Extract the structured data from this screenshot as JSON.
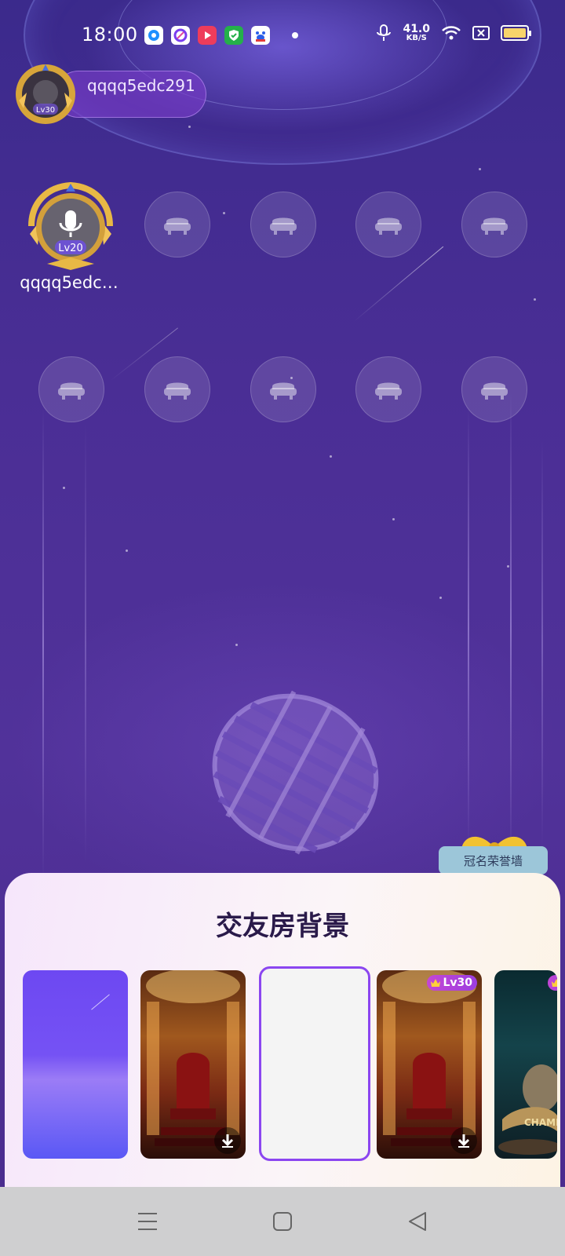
{
  "status_bar": {
    "time": "18:00",
    "apps": [
      "circle-app-icon",
      "ring-app-icon",
      "video-app-icon",
      "shield-app-icon",
      "baidu-app-icon"
    ],
    "net_speed": "41.0",
    "net_unit": "KB/S",
    "battery_color": "#f7d46b"
  },
  "owner": {
    "name": "qqqq5edc291",
    "level": "Lv30"
  },
  "host_seat": {
    "name": "qqqq5edc…",
    "level": "Lv20",
    "icon": "microphone-icon"
  },
  "empty_seat_icon": "sofa-icon",
  "honor_wall": {
    "label": "冠名荣誉墙"
  },
  "background_sheet": {
    "title": "交友房背景",
    "cards": [
      {
        "theme": "purple-galaxy"
      },
      {
        "theme": "golden-throne",
        "downloadable": true
      },
      {
        "theme": "blank",
        "selected": true
      },
      {
        "theme": "golden-throne",
        "level": "Lv30",
        "downloadable": true
      },
      {
        "theme": "champion-microphone",
        "text": "CHAMPI"
      }
    ]
  },
  "nav_bar": {
    "buttons": [
      "menu",
      "home",
      "back"
    ]
  },
  "colors": {
    "accent": "#8b46f0",
    "room_bg": "#4a2f93",
    "badge_bg": "#9cc6d9"
  }
}
